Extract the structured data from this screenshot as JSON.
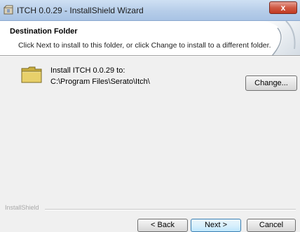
{
  "window": {
    "title": "ITCH 0.0.29 - InstallShield Wizard",
    "close_glyph": "x"
  },
  "header": {
    "title": "Destination Folder",
    "subtitle": "Click Next to install to this folder, or click Change to install to a different folder."
  },
  "destination": {
    "label": "Install ITCH 0.0.29 to:",
    "path": "C:\\Program Files\\Serato\\Itch\\",
    "icon": "folder-icon",
    "change_label": "Change..."
  },
  "footer": {
    "brand": "InstallShield",
    "back_label": "< Back",
    "next_label": "Next >",
    "cancel_label": "Cancel"
  },
  "colors": {
    "titlebar": "#b6cde9",
    "close_button": "#cf5a44",
    "default_button_border": "#3c7fb1",
    "folder": "#e8d06a"
  }
}
